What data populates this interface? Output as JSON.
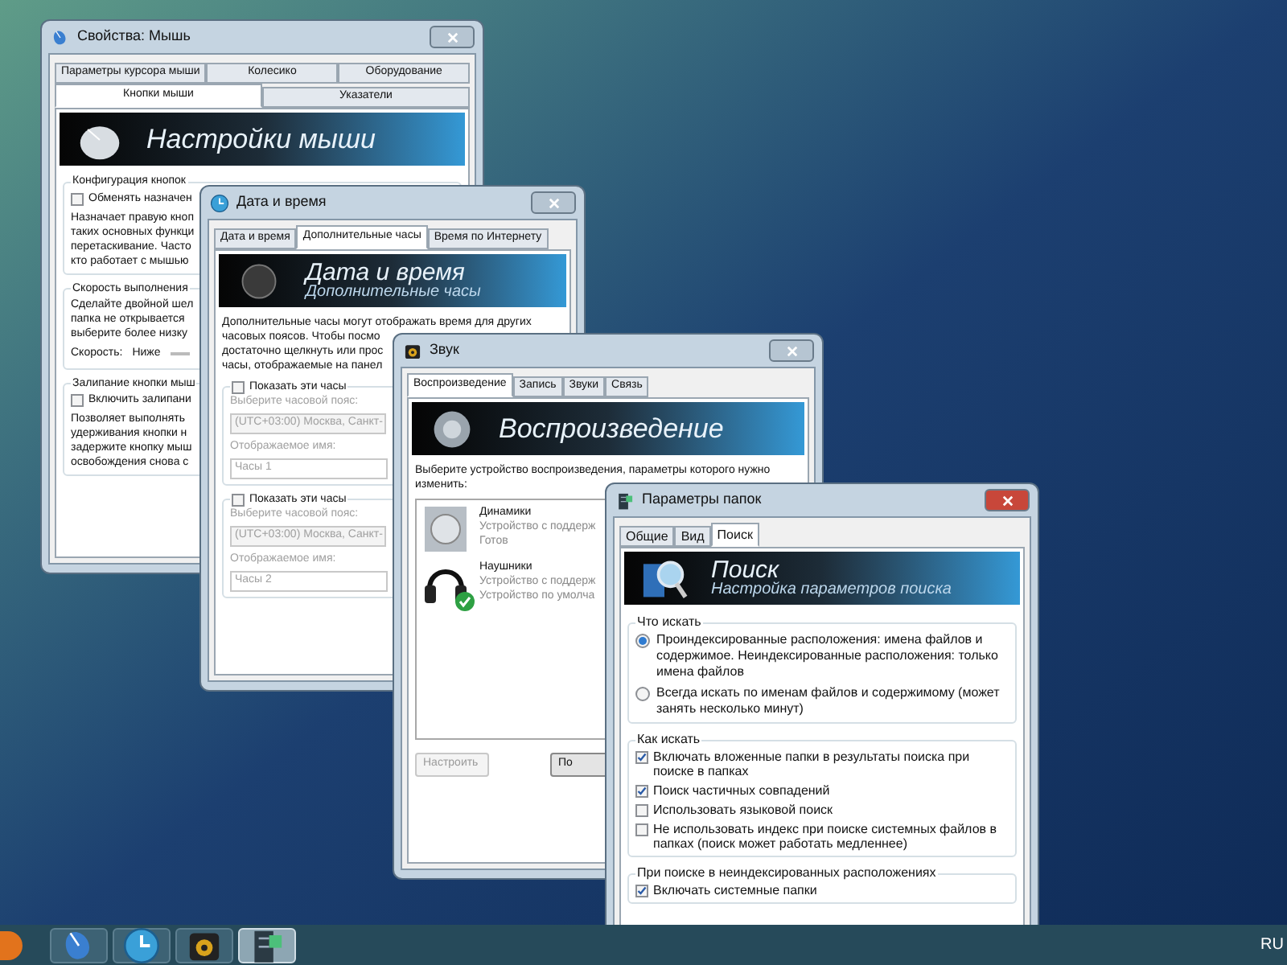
{
  "windows": [
    {
      "kind": "mouse",
      "title": "Свойства: Мышь",
      "active": false,
      "tab_rows": [
        [
          {
            "label": "Параметры курсора мыши",
            "selected": false
          },
          {
            "label": "Колесико",
            "selected": false
          },
          {
            "label": "Оборудование",
            "selected": false
          }
        ],
        [
          {
            "label": "Кнопки мыши",
            "selected": true
          },
          {
            "label": "Указатели",
            "selected": false
          }
        ]
      ],
      "banner": {
        "title": "Настройки мыши"
      },
      "body": [
        {
          "kind": "group",
          "title": "Конфигурация кнопок",
          "items": [
            {
              "kind": "checkbox",
              "label": "Обменять назначен",
              "checked": false
            },
            {
              "kind": "text",
              "lines": [
                "Назначает правую кноп",
                "таких основных функци",
                "перетаскивание. Часто",
                "кто работает с мышью"
              ]
            }
          ]
        },
        {
          "kind": "group",
          "title": "Скорость выполнения",
          "items": [
            {
              "kind": "text",
              "lines": [
                "Сделайте двойной шел",
                "папка не открывается",
                "выберите более низку"
              ]
            },
            {
              "kind": "speed",
              "label": "Скорость:",
              "value": "Ниже"
            }
          ]
        },
        {
          "kind": "group",
          "title": "Залипание кнопки мыш",
          "items": [
            {
              "kind": "checkbox",
              "label": "Включить залипани",
              "checked": false
            },
            {
              "kind": "text",
              "lines": [
                "Позволяет выполнять",
                "удерживания кнопки н",
                "задержите кнопку мыш",
                "освобождения снова с"
              ]
            }
          ]
        }
      ]
    },
    {
      "kind": "clock",
      "title": "Дата и время",
      "active": false,
      "tab_rows": [
        [
          {
            "label": "Дата и время",
            "selected": false
          },
          {
            "label": "Дополнительные часы",
            "selected": true
          },
          {
            "label": "Время по Интернету",
            "selected": false
          }
        ]
      ],
      "banner": {
        "title": "Дата и время",
        "subtitle": "Дополнительные часы"
      },
      "body": [
        {
          "kind": "text",
          "lines": [
            "Дополнительные часы могут отображать время для других",
            "часовых поясов. Чтобы посмо",
            "достаточно щелкнуть или прос",
            "часы, отображаемые на панел"
          ]
        },
        {
          "kind": "group",
          "checkbox": {
            "label": "Показать эти часы",
            "checked": false
          },
          "items": [
            {
              "kind": "label",
              "text": "Выберите часовой пояс:",
              "disabled": true
            },
            {
              "kind": "select",
              "value": "(UTC+03:00) Москва, Санкт-",
              "disabled": true
            },
            {
              "kind": "label",
              "text": "Отображаемое имя:",
              "disabled": true
            },
            {
              "kind": "input",
              "value": "Часы 1",
              "disabled": true
            }
          ]
        },
        {
          "kind": "group",
          "checkbox": {
            "label": "Показать эти часы",
            "checked": false
          },
          "items": [
            {
              "kind": "label",
              "text": "Выберите часовой пояс:",
              "disabled": true
            },
            {
              "kind": "select",
              "value": "(UTC+03:00) Москва, Санкт-",
              "disabled": true
            },
            {
              "kind": "label",
              "text": "Отображаемое имя:",
              "disabled": true
            },
            {
              "kind": "input",
              "value": "Часы 2",
              "disabled": true
            }
          ]
        }
      ]
    },
    {
      "kind": "sound",
      "title": "Звук",
      "active": false,
      "tab_rows": [
        [
          {
            "label": "Воспроизведение",
            "selected": true
          },
          {
            "label": "Запись",
            "selected": false
          },
          {
            "label": "Звуки",
            "selected": false
          },
          {
            "label": "Связь",
            "selected": false
          }
        ]
      ],
      "banner": {
        "title": "Воспроизведение"
      },
      "body": [
        {
          "kind": "text",
          "lines": [
            "Выберите устройство воспроизведения, параметры которого нужно",
            "изменить:"
          ]
        },
        {
          "kind": "devices",
          "items": [
            {
              "kind": "speaker",
              "name": "Динамики",
              "lines": [
                "Устройство с поддерж",
                "Готов"
              ],
              "default": false
            },
            {
              "kind": "headphones",
              "name": "Наушники",
              "lines": [
                "Устройство с поддерж",
                "Устройство по умолча"
              ],
              "default": true
            }
          ]
        },
        {
          "kind": "buttons",
          "items": [
            {
              "label": "Настроить",
              "disabled": true
            },
            {
              "label": "По",
              "disabled": false
            }
          ]
        }
      ]
    },
    {
      "kind": "search",
      "title": "Параметры папок",
      "active": true,
      "tab_rows": [
        [
          {
            "label": "Общие",
            "selected": false
          },
          {
            "label": "Вид",
            "selected": false
          },
          {
            "label": "Поиск",
            "selected": true
          }
        ]
      ],
      "banner": {
        "title": "Поиск",
        "subtitle": "Настройка параметров поиска"
      },
      "body": [
        {
          "kind": "group",
          "title": "Что искать",
          "items": [
            {
              "kind": "radio",
              "label": "Проиндексированные расположения: имена файлов и содержимое. Неиндексированные расположения: только имена файлов",
              "selected": true
            },
            {
              "kind": "radio",
              "label": "Всегда искать по именам файлов и содержимому (может занять несколько минут)",
              "selected": false
            }
          ]
        },
        {
          "kind": "group",
          "title": "Как искать",
          "items": [
            {
              "kind": "checkbox",
              "label": "Включать вложенные папки в результаты поиска при поиске в папках",
              "checked": true
            },
            {
              "kind": "checkbox",
              "label": "Поиск частичных совпадений",
              "checked": true
            },
            {
              "kind": "checkbox",
              "label": "Использовать языковой поиск",
              "checked": false
            },
            {
              "kind": "checkbox",
              "label": "Не использовать индекс при поиске системных файлов в папках (поиск может работать медленнее)",
              "checked": false
            }
          ]
        },
        {
          "kind": "group",
          "title": "При поиске в неиндексированных расположениях",
          "items": [
            {
              "kind": "checkbox",
              "label": "Включать системные папки",
              "checked": true
            }
          ]
        }
      ]
    }
  ],
  "taskbar": {
    "apps": [
      {
        "kind": "mouse",
        "selected": false
      },
      {
        "kind": "clock",
        "selected": false
      },
      {
        "kind": "sound",
        "selected": false
      },
      {
        "kind": "search",
        "selected": true
      }
    ],
    "language": "RU"
  }
}
